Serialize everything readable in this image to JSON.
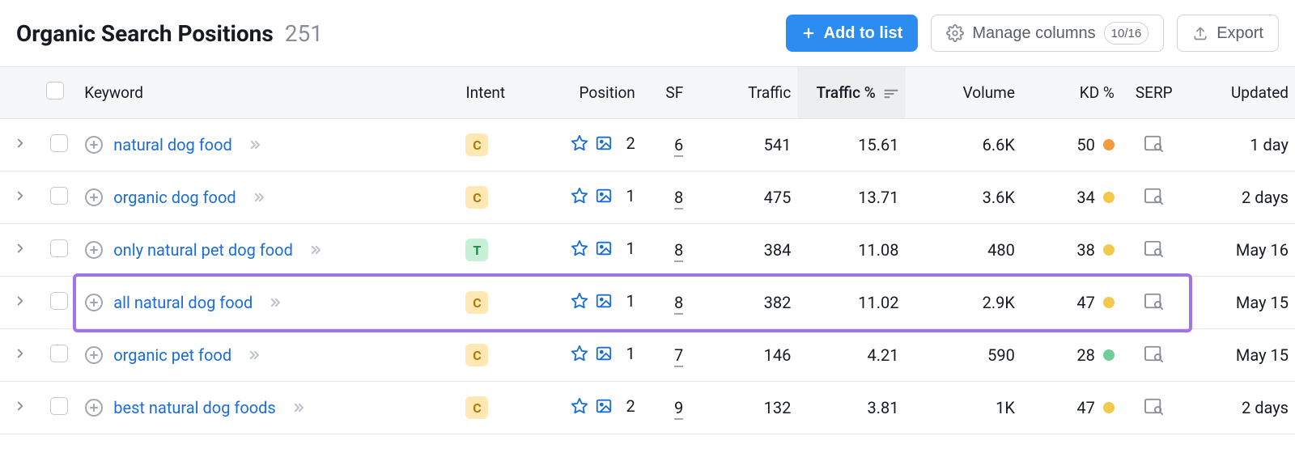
{
  "header": {
    "title": "Organic Search Positions",
    "count": "251",
    "add_label": "Add to list",
    "manage_label": "Manage columns",
    "manage_badge": "10/16",
    "export_label": "Export"
  },
  "columns": {
    "keyword": "Keyword",
    "intent": "Intent",
    "position": "Position",
    "sf": "SF",
    "traffic": "Traffic",
    "traffic_pct": "Traffic %",
    "volume": "Volume",
    "kd": "KD %",
    "serp": "SERP",
    "updated": "Updated"
  },
  "rows": [
    {
      "keyword": "natural dog food",
      "intent": "C",
      "position": "2",
      "sf": "6",
      "traffic": "541",
      "traffic_pct": "15.61",
      "volume": "6.6K",
      "kd": "50",
      "kd_color": "orange",
      "updated": "1 day",
      "highlight": false
    },
    {
      "keyword": "organic dog food",
      "intent": "C",
      "position": "1",
      "sf": "8",
      "traffic": "475",
      "traffic_pct": "13.71",
      "volume": "3.6K",
      "kd": "34",
      "kd_color": "yellow",
      "updated": "2 days",
      "highlight": false
    },
    {
      "keyword": "only natural pet dog food",
      "intent": "T",
      "position": "1",
      "sf": "8",
      "traffic": "384",
      "traffic_pct": "11.08",
      "volume": "480",
      "kd": "38",
      "kd_color": "yellow",
      "updated": "May 16",
      "highlight": false
    },
    {
      "keyword": "all natural dog food",
      "intent": "C",
      "position": "1",
      "sf": "8",
      "traffic": "382",
      "traffic_pct": "11.02",
      "volume": "2.9K",
      "kd": "47",
      "kd_color": "yellow",
      "updated": "May 15",
      "highlight": true
    },
    {
      "keyword": "organic pet food",
      "intent": "C",
      "position": "1",
      "sf": "7",
      "traffic": "146",
      "traffic_pct": "4.21",
      "volume": "590",
      "kd": "28",
      "kd_color": "green",
      "updated": "May 15",
      "highlight": false
    },
    {
      "keyword": "best natural dog foods",
      "intent": "C",
      "position": "2",
      "sf": "9",
      "traffic": "132",
      "traffic_pct": "3.81",
      "volume": "1K",
      "kd": "47",
      "kd_color": "yellow",
      "updated": "2 days",
      "highlight": false
    }
  ]
}
